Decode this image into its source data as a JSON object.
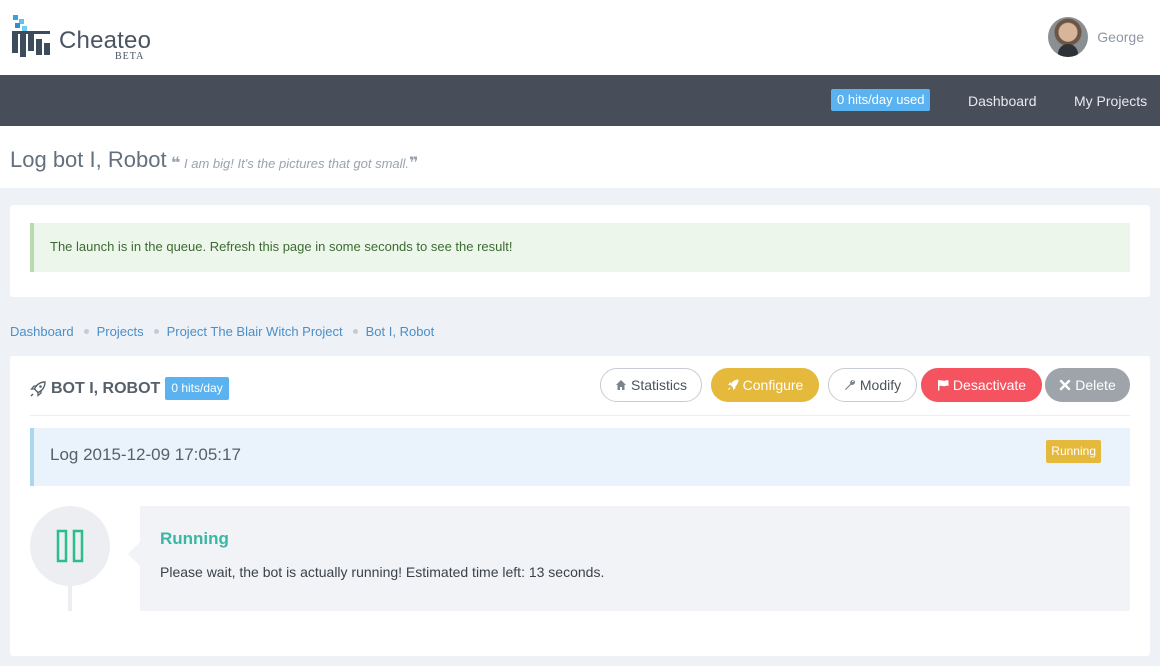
{
  "brand": {
    "name": "Cheateo",
    "tag": "BETA"
  },
  "user": {
    "name": "George"
  },
  "nav": {
    "hits_badge": "0 hits/day used",
    "items": [
      {
        "label": "Dashboard"
      },
      {
        "label": "My Projects"
      }
    ]
  },
  "page": {
    "title": "Log bot I, Robot",
    "quote": "I am big! It's the pictures that got small."
  },
  "alert": {
    "message": "The launch is in the queue. Refresh this page in some seconds to see the result!"
  },
  "breadcrumb": [
    "Dashboard",
    "Projects",
    "Project The Blair Witch Project",
    "Bot I, Robot"
  ],
  "bot": {
    "name": "BOT I, ROBOT",
    "hits": "0 hits/day",
    "icon": "rocket-icon",
    "buttons": {
      "statistics": "Statistics",
      "configure": "Configure",
      "modify": "Modify",
      "desactivate": "Desactivate",
      "delete": "Delete"
    }
  },
  "log": {
    "title": "Log 2015-12-09 17:05:17",
    "status": "Running"
  },
  "timeline": {
    "icon": "pause-icon",
    "heading": "Running",
    "text": "Please wait, the bot is actually running! Estimated time left: 13 seconds."
  },
  "colors": {
    "navbar": "#474e5a",
    "accent_blue": "#5bb2f0",
    "configure": "#e5b93b",
    "desactivate": "#f4535f",
    "delete": "#9ea4a9",
    "running_green": "#3ab7a4"
  }
}
